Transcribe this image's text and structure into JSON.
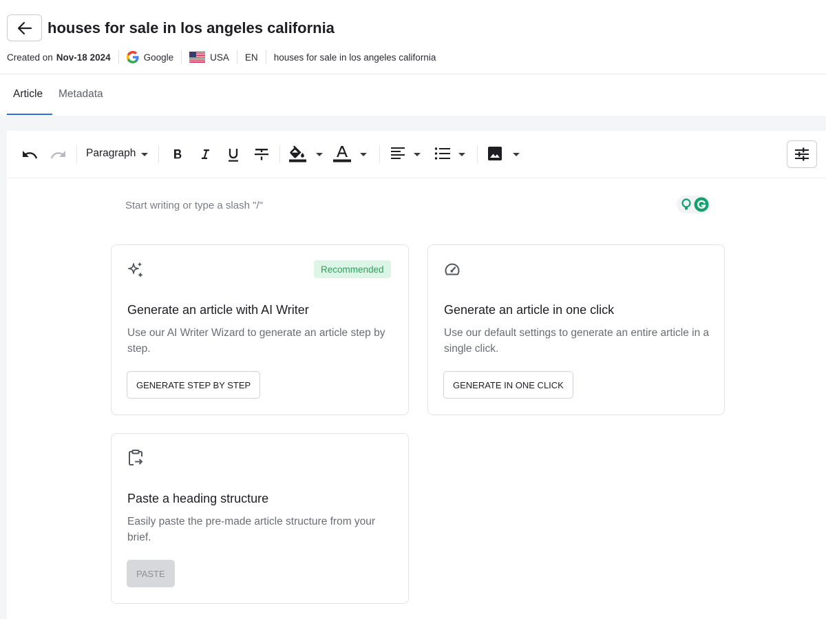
{
  "header": {
    "title": "houses for sale in los angeles california",
    "created_label": "Created on",
    "created_date": "Nov-18 2024",
    "search_engine": "Google",
    "country": "USA",
    "language": "EN",
    "keyword": "houses for sale in los angeles california"
  },
  "tabs": [
    {
      "label": "Article",
      "active": true
    },
    {
      "label": "Metadata",
      "active": false
    }
  ],
  "toolbar": {
    "block_format": "Paragraph"
  },
  "editor": {
    "placeholder": "Start writing or type a slash \"/\""
  },
  "cards": {
    "ai_writer": {
      "badge": "Recommended",
      "title": "Generate an article with AI Writer",
      "description": "Use our AI Writer Wizard to generate an article step by step.",
      "button": "GENERATE STEP BY STEP"
    },
    "one_click": {
      "title": "Generate an article in one click",
      "description": "Use our default settings to generate an entire article in a single click.",
      "button": "GENERATE IN ONE CLICK"
    },
    "paste": {
      "title": "Paste a heading structure",
      "description": "Easily paste the pre-made article structure from your brief.",
      "button": "PASTE"
    }
  },
  "colors": {
    "accent": "#2d6fd8",
    "badge_bg": "#ddf5e7",
    "badge_text": "#2f9e5c",
    "grammarly": "#15a16f"
  }
}
